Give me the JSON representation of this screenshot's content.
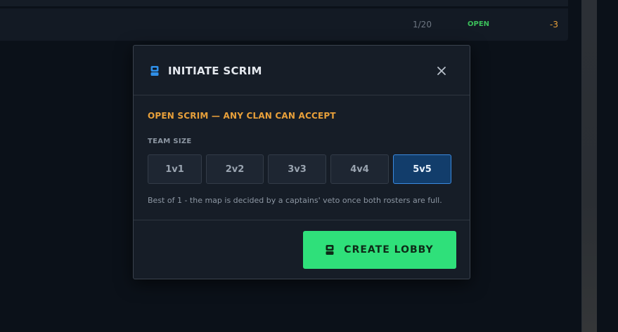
{
  "background_row": {
    "count": "1/20",
    "status": "OPEN",
    "delta": "-3"
  },
  "modal": {
    "title": "INITIATE SCRIM",
    "header_icon": "headset-icon",
    "close_icon": "close-icon",
    "scrim_type": "OPEN SCRIM — ANY CLAN CAN ACCEPT",
    "team_size_label": "TEAM SIZE",
    "team_sizes": [
      {
        "label": "1v1",
        "selected": false
      },
      {
        "label": "2v2",
        "selected": false
      },
      {
        "label": "3v3",
        "selected": false
      },
      {
        "label": "4v4",
        "selected": false
      },
      {
        "label": "5v5",
        "selected": true
      }
    ],
    "hint": "Best of 1 - the map is decided by a captains' veto once both rosters are full.",
    "create_button_label": "CREATE LOBBY",
    "create_button_icon": "headset-icon"
  },
  "colors": {
    "accent_orange": "#e8a03a",
    "accent_green": "#2fe07a",
    "accent_blue": "#3a8ae0",
    "status_green": "#3bbf5a"
  }
}
